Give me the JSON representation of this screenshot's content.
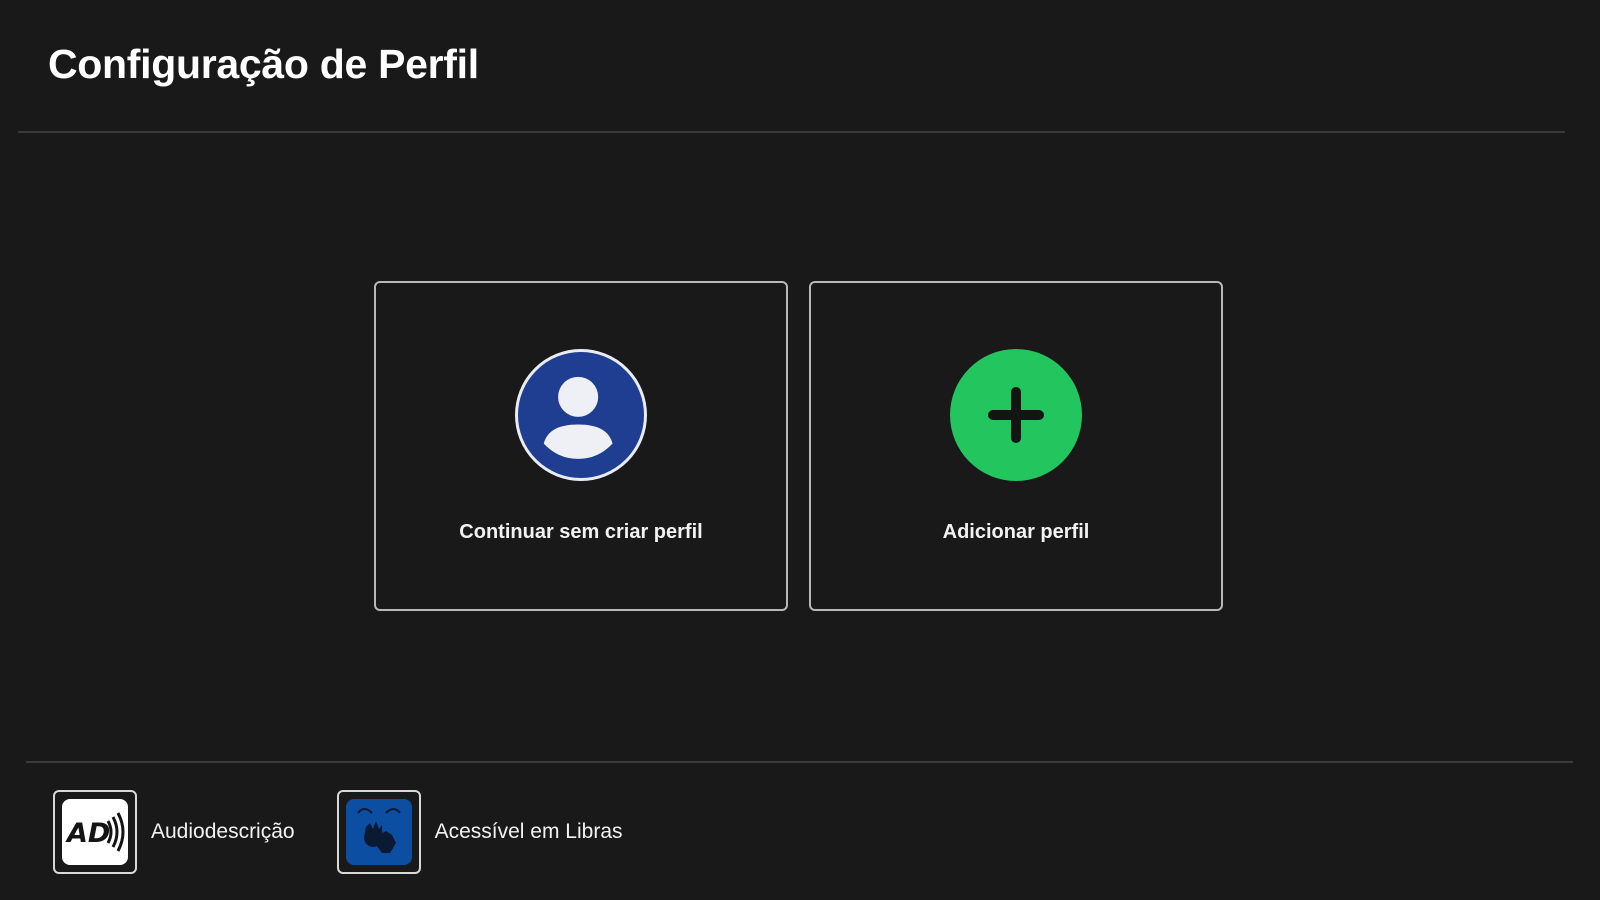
{
  "header": {
    "title": "Configuração de Perfil"
  },
  "profiles": {
    "continue_label": "Continuar sem criar perfil",
    "continue_icon": "user-avatar-icon",
    "add_label": "Adicionar perfil",
    "add_icon": "plus-icon"
  },
  "footer": {
    "audio_description_label": "Audiodescrição",
    "audio_description_icon": "audio-description-icon",
    "audio_description_badge_text": "AD",
    "libras_label": "Acessível em Libras",
    "libras_icon": "sign-language-icon"
  },
  "colors": {
    "background": "#19191a",
    "user_avatar": "#1f3e91",
    "add_button": "#22c55e",
    "libras_badge": "#0b4ea2",
    "card_border": "#b8b8bb"
  }
}
